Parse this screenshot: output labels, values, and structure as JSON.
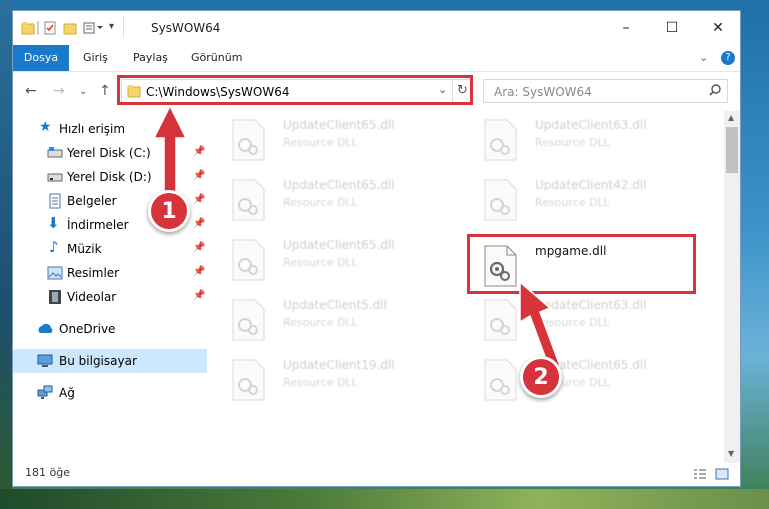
{
  "window": {
    "title": "SysWOW64",
    "controls": {
      "minimize": "–",
      "maximize": "☐",
      "close": "✕"
    }
  },
  "ribbon": {
    "tabs": [
      "Dosya",
      "Giriş",
      "Paylaş",
      "Görünüm"
    ],
    "expand_icon": "chevron-down-icon",
    "help": "?"
  },
  "address": {
    "path": "C:\\Windows\\SysWOW64",
    "search_placeholder": "Ara: SysWOW64"
  },
  "nav": {
    "quick_access": "Hızlı erişim",
    "items": [
      {
        "label": "Yerel Disk (C:)",
        "pinned": true
      },
      {
        "label": "Yerel Disk (D:)",
        "pinned": true
      },
      {
        "label": "Belgeler",
        "pinned": true
      },
      {
        "label": "İndirmeler",
        "pinned": true
      },
      {
        "label": "Müzik",
        "pinned": true
      },
      {
        "label": "Resimler",
        "pinned": true
      },
      {
        "label": "Videolar",
        "pinned": true
      }
    ],
    "onedrive": "OneDrive",
    "this_pc": "Bu bilgisayar",
    "network": "Ağ"
  },
  "files": [
    {
      "name": "UpdateClient65.dll",
      "type": "Resource DLL"
    },
    {
      "name": "UpdateClient63.dll",
      "type": "Resource DLL"
    },
    {
      "name": "UpdateClient65.dll",
      "type": "Resource DLL"
    },
    {
      "name": "UpdateClient42.dll",
      "type": "Resource DLL"
    },
    {
      "name": "UpdateClient65.dll",
      "type": "Resource DLL"
    },
    {
      "name": "mpgame.dll",
      "type": ""
    },
    {
      "name": "UpdateClient5.dll",
      "type": "Resource DLL"
    },
    {
      "name": "UpdateClient63.dll",
      "type": "Resource DLL"
    },
    {
      "name": "UpdateClient19.dll",
      "type": "Resource DLL"
    },
    {
      "name": "UpdateClient65.dll",
      "type": "Resource DLL"
    }
  ],
  "status": {
    "count": "181 öğe"
  },
  "annotations": {
    "step1": "1",
    "step2": "2",
    "accent": "#d7333b"
  }
}
